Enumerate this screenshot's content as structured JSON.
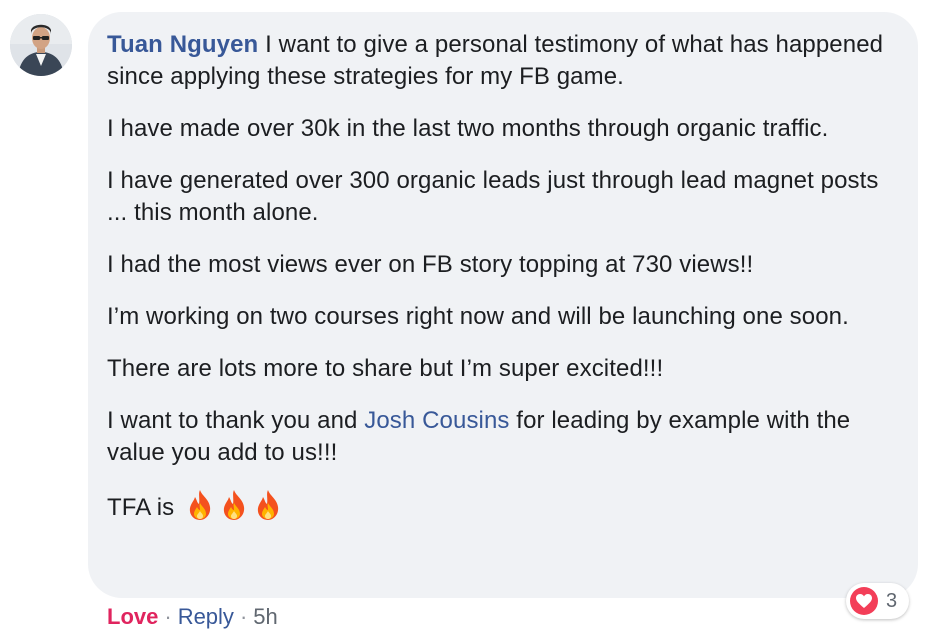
{
  "comment": {
    "author": "Tuan Nguyen",
    "paragraphs": [
      "I want to give a personal testimony of what has happened since applying these strategies for my FB game.",
      "I have made over 30k in the last two months through organic traffic.",
      "I have generated over 300 organic leads just through lead magnet posts ... this month alone.",
      "I had the most views ever on FB story topping at 730 views!!",
      "I’m working on two courses right now and will be launching one soon.",
      "There are lots more to share but I’m super excited!!!"
    ],
    "thanks_before": "I want to thank you and ",
    "mention": "Josh Cousins",
    "thanks_after": " for leading by example with the value you add to us!!!",
    "closing_text": "TFA is ",
    "closing_emojis": [
      "fire-emoji",
      "fire-emoji",
      "fire-emoji"
    ]
  },
  "actions": {
    "love_label": "Love",
    "separator": "·",
    "reply_label": "Reply",
    "timestamp": "5h"
  },
  "reactions": {
    "icon": "heart-icon",
    "count": "3"
  },
  "colors": {
    "bubble_bg": "#f0f2f5",
    "link": "#385898",
    "love": "#e0245e",
    "heart_badge": "#f33e58",
    "meta": "#606770"
  }
}
